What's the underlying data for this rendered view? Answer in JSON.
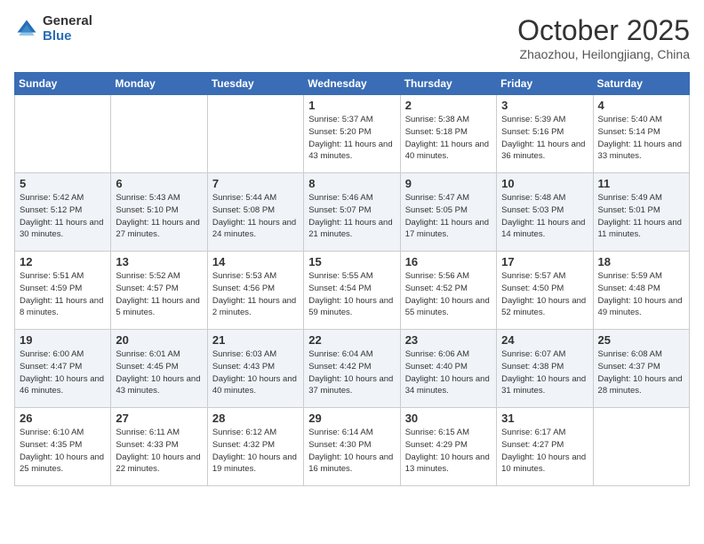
{
  "header": {
    "logo_general": "General",
    "logo_blue": "Blue",
    "month_title": "October 2025",
    "location": "Zhaozhou, Heilongjiang, China"
  },
  "days_of_week": [
    "Sunday",
    "Monday",
    "Tuesday",
    "Wednesday",
    "Thursday",
    "Friday",
    "Saturday"
  ],
  "weeks": [
    [
      {
        "day": "",
        "sunrise": "",
        "sunset": "",
        "daylight": ""
      },
      {
        "day": "",
        "sunrise": "",
        "sunset": "",
        "daylight": ""
      },
      {
        "day": "",
        "sunrise": "",
        "sunset": "",
        "daylight": ""
      },
      {
        "day": "1",
        "sunrise": "Sunrise: 5:37 AM",
        "sunset": "Sunset: 5:20 PM",
        "daylight": "Daylight: 11 hours and 43 minutes."
      },
      {
        "day": "2",
        "sunrise": "Sunrise: 5:38 AM",
        "sunset": "Sunset: 5:18 PM",
        "daylight": "Daylight: 11 hours and 40 minutes."
      },
      {
        "day": "3",
        "sunrise": "Sunrise: 5:39 AM",
        "sunset": "Sunset: 5:16 PM",
        "daylight": "Daylight: 11 hours and 36 minutes."
      },
      {
        "day": "4",
        "sunrise": "Sunrise: 5:40 AM",
        "sunset": "Sunset: 5:14 PM",
        "daylight": "Daylight: 11 hours and 33 minutes."
      }
    ],
    [
      {
        "day": "5",
        "sunrise": "Sunrise: 5:42 AM",
        "sunset": "Sunset: 5:12 PM",
        "daylight": "Daylight: 11 hours and 30 minutes."
      },
      {
        "day": "6",
        "sunrise": "Sunrise: 5:43 AM",
        "sunset": "Sunset: 5:10 PM",
        "daylight": "Daylight: 11 hours and 27 minutes."
      },
      {
        "day": "7",
        "sunrise": "Sunrise: 5:44 AM",
        "sunset": "Sunset: 5:08 PM",
        "daylight": "Daylight: 11 hours and 24 minutes."
      },
      {
        "day": "8",
        "sunrise": "Sunrise: 5:46 AM",
        "sunset": "Sunset: 5:07 PM",
        "daylight": "Daylight: 11 hours and 21 minutes."
      },
      {
        "day": "9",
        "sunrise": "Sunrise: 5:47 AM",
        "sunset": "Sunset: 5:05 PM",
        "daylight": "Daylight: 11 hours and 17 minutes."
      },
      {
        "day": "10",
        "sunrise": "Sunrise: 5:48 AM",
        "sunset": "Sunset: 5:03 PM",
        "daylight": "Daylight: 11 hours and 14 minutes."
      },
      {
        "day": "11",
        "sunrise": "Sunrise: 5:49 AM",
        "sunset": "Sunset: 5:01 PM",
        "daylight": "Daylight: 11 hours and 11 minutes."
      }
    ],
    [
      {
        "day": "12",
        "sunrise": "Sunrise: 5:51 AM",
        "sunset": "Sunset: 4:59 PM",
        "daylight": "Daylight: 11 hours and 8 minutes."
      },
      {
        "day": "13",
        "sunrise": "Sunrise: 5:52 AM",
        "sunset": "Sunset: 4:57 PM",
        "daylight": "Daylight: 11 hours and 5 minutes."
      },
      {
        "day": "14",
        "sunrise": "Sunrise: 5:53 AM",
        "sunset": "Sunset: 4:56 PM",
        "daylight": "Daylight: 11 hours and 2 minutes."
      },
      {
        "day": "15",
        "sunrise": "Sunrise: 5:55 AM",
        "sunset": "Sunset: 4:54 PM",
        "daylight": "Daylight: 10 hours and 59 minutes."
      },
      {
        "day": "16",
        "sunrise": "Sunrise: 5:56 AM",
        "sunset": "Sunset: 4:52 PM",
        "daylight": "Daylight: 10 hours and 55 minutes."
      },
      {
        "day": "17",
        "sunrise": "Sunrise: 5:57 AM",
        "sunset": "Sunset: 4:50 PM",
        "daylight": "Daylight: 10 hours and 52 minutes."
      },
      {
        "day": "18",
        "sunrise": "Sunrise: 5:59 AM",
        "sunset": "Sunset: 4:48 PM",
        "daylight": "Daylight: 10 hours and 49 minutes."
      }
    ],
    [
      {
        "day": "19",
        "sunrise": "Sunrise: 6:00 AM",
        "sunset": "Sunset: 4:47 PM",
        "daylight": "Daylight: 10 hours and 46 minutes."
      },
      {
        "day": "20",
        "sunrise": "Sunrise: 6:01 AM",
        "sunset": "Sunset: 4:45 PM",
        "daylight": "Daylight: 10 hours and 43 minutes."
      },
      {
        "day": "21",
        "sunrise": "Sunrise: 6:03 AM",
        "sunset": "Sunset: 4:43 PM",
        "daylight": "Daylight: 10 hours and 40 minutes."
      },
      {
        "day": "22",
        "sunrise": "Sunrise: 6:04 AM",
        "sunset": "Sunset: 4:42 PM",
        "daylight": "Daylight: 10 hours and 37 minutes."
      },
      {
        "day": "23",
        "sunrise": "Sunrise: 6:06 AM",
        "sunset": "Sunset: 4:40 PM",
        "daylight": "Daylight: 10 hours and 34 minutes."
      },
      {
        "day": "24",
        "sunrise": "Sunrise: 6:07 AM",
        "sunset": "Sunset: 4:38 PM",
        "daylight": "Daylight: 10 hours and 31 minutes."
      },
      {
        "day": "25",
        "sunrise": "Sunrise: 6:08 AM",
        "sunset": "Sunset: 4:37 PM",
        "daylight": "Daylight: 10 hours and 28 minutes."
      }
    ],
    [
      {
        "day": "26",
        "sunrise": "Sunrise: 6:10 AM",
        "sunset": "Sunset: 4:35 PM",
        "daylight": "Daylight: 10 hours and 25 minutes."
      },
      {
        "day": "27",
        "sunrise": "Sunrise: 6:11 AM",
        "sunset": "Sunset: 4:33 PM",
        "daylight": "Daylight: 10 hours and 22 minutes."
      },
      {
        "day": "28",
        "sunrise": "Sunrise: 6:12 AM",
        "sunset": "Sunset: 4:32 PM",
        "daylight": "Daylight: 10 hours and 19 minutes."
      },
      {
        "day": "29",
        "sunrise": "Sunrise: 6:14 AM",
        "sunset": "Sunset: 4:30 PM",
        "daylight": "Daylight: 10 hours and 16 minutes."
      },
      {
        "day": "30",
        "sunrise": "Sunrise: 6:15 AM",
        "sunset": "Sunset: 4:29 PM",
        "daylight": "Daylight: 10 hours and 13 minutes."
      },
      {
        "day": "31",
        "sunrise": "Sunrise: 6:17 AM",
        "sunset": "Sunset: 4:27 PM",
        "daylight": "Daylight: 10 hours and 10 minutes."
      },
      {
        "day": "",
        "sunrise": "",
        "sunset": "",
        "daylight": ""
      }
    ]
  ]
}
